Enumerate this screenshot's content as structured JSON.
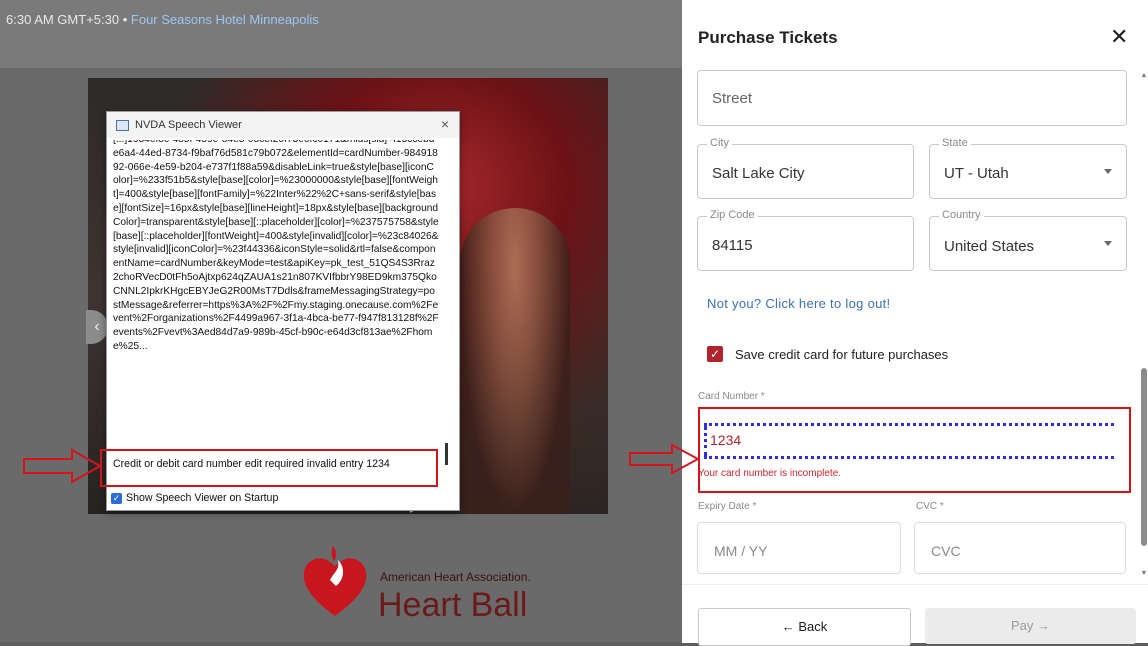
{
  "background_page": {
    "time_text": "6:30 AM GMT+5:30",
    "separator": "•",
    "venue": "Four Seasons Hotel Minneapolis",
    "logo_org": "American Heart Association.",
    "logo_event": "Heart Ball"
  },
  "nvda": {
    "title": "NVDA Speech Viewer",
    "close": "×",
    "raw_text": "[...]1934ef8c-485f-459e-84e8-05cef20f73e0fc0171&mids[sid]=f15ccebd-e6a4-44ed-8734-f9baf76d581c79b072&elementId=cardNumber-98491892-066e-4e59-b204-e737f1f88a59&disableLink=true&style[base][iconColor]=%233f51b5&style[base][color]=%23000000&style[base][fontWeight]=400&style[base][fontFamily]=%22Inter%22%2C+sans-serif&style[base][fontSize]=16px&style[base][lineHeight]=18px&style[base][backgroundColor]=transparent&style[base][::placeholder][color]=%237575758&style[base][::placeholder][fontWeight]=400&style[invalid][color]=%23c84026&style[invalid][iconColor]=%23f44336&iconStyle=solid&rtl=false&componentName=cardNumber&keyMode=test&apiKey=pk_test_51QS4S3Rraz2choRVecD0tFh5oAjtxp624qZAUA1s21n807KVIfbbrY98ED9km375QkoCNNL2IpkrKHgcEBYJeG2R00MsT7Ddls&frameMessagingStrategy=postMessage&referrer=https%3A%2F%2Fmy.staging.onecause.com%2Fevent%2Forganizations%2F4499a967-3f1a-4bca-be77-f947f813128f%2Fevents%2Fvevt%3Aed84d7a9-989b-45cf-b90c-e64d3cf813ae%2Fhome%25...",
    "last_line": "Credit or debit card number  edit  required  invalid entry  1234",
    "startup_label": "Show Speech Viewer on Startup",
    "startup_checked": true
  },
  "panel": {
    "title": "Purchase Tickets",
    "close": "✕",
    "street_placeholder": "Street",
    "city_label": "City",
    "city_value": "Salt Lake City",
    "state_label": "State",
    "state_value": "UT - Utah",
    "zip_label": "Zip Code",
    "zip_value": "84115",
    "country_label": "Country",
    "country_value": "United States",
    "logout_link": "Not you? Click here to log out!",
    "save_card_label": "Save credit card for future purchases",
    "save_card_checked": true,
    "card_number_label": "Card Number *",
    "card_number_value": "1234",
    "card_error": "Your card number is incomplete.",
    "expiry_label": "Expiry Date *",
    "expiry_placeholder": "MM / YY",
    "cvc_label": "CVC *",
    "cvc_placeholder": "CVC",
    "back_button": "← Back",
    "pay_button": "Pay →"
  },
  "colors": {
    "accent_red": "#b0242c",
    "annotation_red": "#d4141c",
    "link_blue": "#3b73b9",
    "focus_blue": "#2e2ee8"
  }
}
